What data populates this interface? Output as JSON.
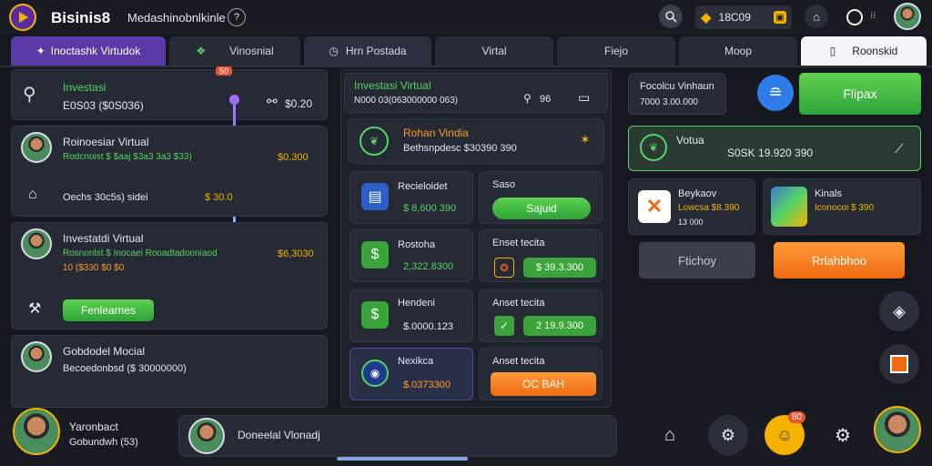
{
  "app": {
    "name": "Bisinis8",
    "subtitle": "Medashinobnlkinle",
    "help": "?"
  },
  "header": {
    "coins": "18C09",
    "brand_color": "#8b3fd6"
  },
  "tabs": [
    {
      "label": "Inoctashk Virtudok",
      "active": true
    },
    {
      "label": "Vinosnial"
    },
    {
      "label": "Hrn  Postada"
    },
    {
      "label": "Virtal"
    },
    {
      "label": "Fiejo"
    },
    {
      "label": "Moop"
    },
    {
      "label": "Roonskid"
    }
  ],
  "left": {
    "card1": {
      "title": "Investasi",
      "sub": "E0S03 ($0S036)",
      "amount": "$0.20",
      "badge": "50"
    },
    "card2": {
      "name": "Roinoesiar Virtual",
      "line": "Rodcnoist $ $aaj  $3a3 3a3 $33)",
      "value": "$0.300",
      "row2": "Oechs 30c5s) sidei",
      "row2_val": "$ 30.0"
    },
    "card3": {
      "name": "Investatdi Virtual",
      "line": "Rosnonlst $ Inocaei Rooadtadooniaod",
      "line2": "10 ($330 $0 $0",
      "value": "$6,3030",
      "button": "Fenlearnes"
    },
    "card4": {
      "name": "Gobdodel Mocial",
      "line": "Becoedonbsd ($ 30000000)"
    }
  },
  "middle": {
    "header": {
      "title": "Investasi Virtual",
      "sub": "N000 03(063000000 063)",
      "count": "96"
    },
    "promo": {
      "title": "Rohan Vindia",
      "sub": "Bethsnpdesc  $30390 390"
    },
    "rows": [
      {
        "name": "Recieloidet",
        "value": "$ 8,600 390",
        "right_label": "Saso",
        "right_btn": "Sajuid"
      },
      {
        "name": "Rostoha",
        "value": "2,322.8300",
        "right_label": "Enset tecita",
        "right_val": "$ 39.3.300"
      },
      {
        "name": "Hendeni",
        "value": "$.0000.123",
        "right_label": "Anset tecita",
        "right_val": "2 19.9.300"
      },
      {
        "name": "Nexikca",
        "value": "$.0373300",
        "right_label": "Anset tecita",
        "right_btn": "OC BAH"
      }
    ]
  },
  "right": {
    "top": {
      "title": "Focolcu Vinhaun",
      "sub": "7000 3.00.000",
      "button": "Flipax"
    },
    "summary": {
      "label": "Votua",
      "value": "S0SK 19.920 390"
    },
    "card_a": {
      "title": "Beykaov",
      "line": "Lowcsa $8.390",
      "line2": "13 000"
    },
    "card_b": {
      "title": "Kinals",
      "line": "Iconocoi $ 390"
    },
    "btn_gray": "Ftichoy",
    "btn_orange": "Rrlahbhoo"
  },
  "footer": {
    "user1": {
      "name": "Yaronbact",
      "sub": "Gobundwh (53)"
    },
    "user2": {
      "name": "Doneelal Vlonadj"
    },
    "badge": "80"
  }
}
